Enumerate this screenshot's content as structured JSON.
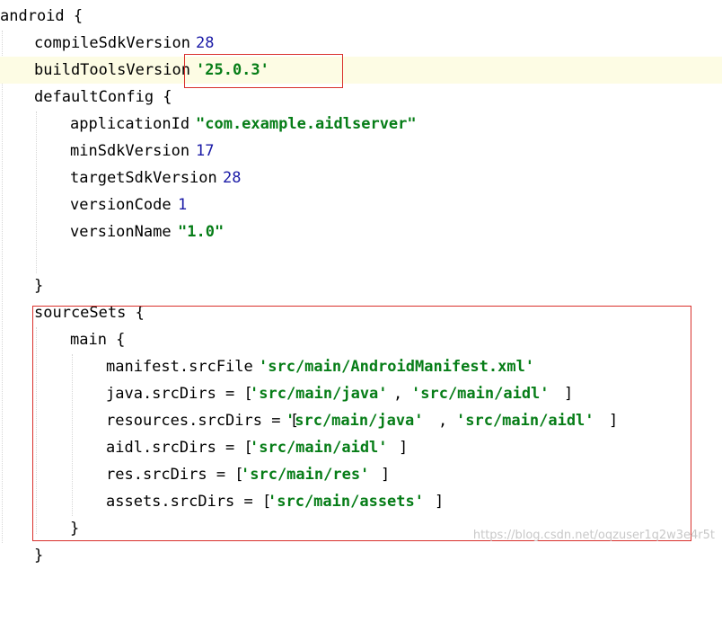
{
  "code": {
    "android": "android {",
    "compileSdk_key": "compileSdkVersion ",
    "compileSdk_val": "28",
    "buildTools_key": "buildToolsVersion ",
    "buildTools_val": "'25.0.3'",
    "defaultConfig": "defaultConfig {",
    "applicationId_key": "applicationId ",
    "applicationId_val": "\"com.example.aidlserver\"",
    "minSdk_key": "minSdkVersion ",
    "minSdk_val": "17",
    "targetSdk_key": "targetSdkVersion ",
    "targetSdk_val": "28",
    "versionCode_key": "versionCode ",
    "versionCode_val": "1",
    "versionName_key": "versionName ",
    "versionName_val": "\"1.0\"",
    "close_defaultConfig": "}",
    "sourceSets": "sourceSets {",
    "main": "main {",
    "manifest_key": "manifest.srcFile ",
    "manifest_val": "'src/main/AndroidManifest.xml'",
    "java_key": "java.srcDirs = [",
    "java_val1": "'src/main/java'",
    "java_sep": ", ",
    "java_val2": "'src/main/aidl'",
    "java_end": "]",
    "resources_key": "resources.srcDirs = [",
    "resources_val1": "'src/main/java'",
    "resources_sep": ", ",
    "resources_val2": "'src/main/aidl'",
    "resources_end": "]",
    "aidl_key": "aidl.srcDirs = [",
    "aidl_val": "'src/main/aidl'",
    "aidl_end": "]",
    "res_key": "res.srcDirs = [",
    "res_val": "'src/main/res'",
    "res_end": "]",
    "assets_key": "assets.srcDirs = [",
    "assets_val": "'src/main/assets'",
    "assets_end": "]",
    "close_main": "}",
    "close_android_partial": "}"
  },
  "watermark": "https://blog.csdn.net/oqzuser1q2w3e4r5t",
  "colors": {
    "number": "#1a1aa6",
    "string": "#067d17",
    "highlight": "#fdfce4",
    "annotation_box": "#d9302c"
  }
}
